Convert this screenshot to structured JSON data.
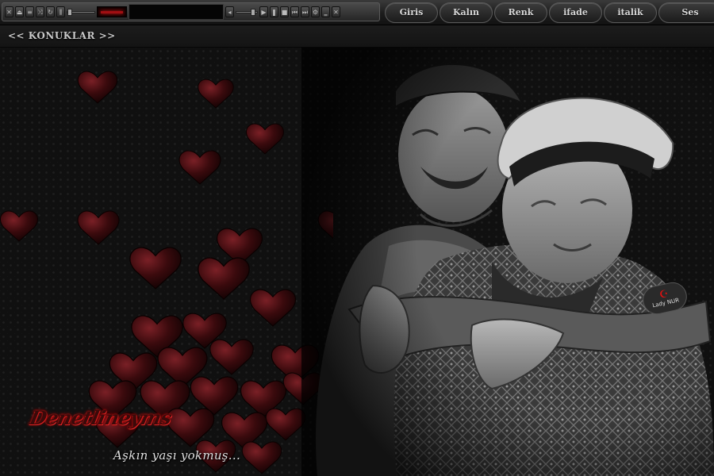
{
  "player": {
    "buttons": [
      "open",
      "eject",
      "shuffle",
      "repeat",
      "eq",
      "seek-back"
    ],
    "transport": [
      "prev",
      "play",
      "pause",
      "stop",
      "next",
      "end"
    ],
    "window_buttons": [
      "options",
      "minimize",
      "close"
    ],
    "red_color": "#a10f12"
  },
  "menu": {
    "tabs": [
      "Giris",
      "Kalın",
      "Renk",
      "ifade",
      "italik",
      "Ses"
    ]
  },
  "subbar": {
    "konuklar": "<< KONUKLAR >>"
  },
  "artwork": {
    "signature": "Denetlineyms",
    "caption": "Aşkın yaşı yokmuş...",
    "badge_mark": "☪",
    "badge_text": "Lady NUR",
    "heart_color": "#3a0a0d"
  }
}
